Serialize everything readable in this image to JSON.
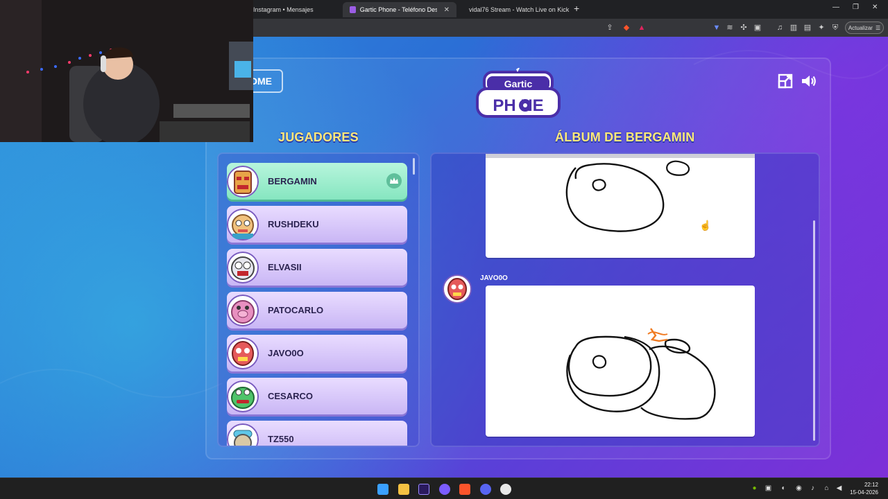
{
  "browser": {
    "tabs": [
      {
        "label": "Instagram • Mensajes",
        "active": false
      },
      {
        "label": "Gartic Phone - Teléfono Descon",
        "active": true
      },
      {
        "label": "vidal76 Stream - Watch Live on Kick",
        "active": false
      }
    ],
    "new_tab": "+",
    "update_label": "Actualizar"
  },
  "game": {
    "home_label": "OME",
    "logo_line1": "Gartic",
    "logo_line2": "PHONE",
    "players_title": "JUGADORES",
    "album_title": "ÁLBUM DE BERGAMIN",
    "players": [
      {
        "name": "BERGAMIN",
        "host": true
      },
      {
        "name": "RUSHDEKU",
        "host": false
      },
      {
        "name": "ELVASII",
        "host": false
      },
      {
        "name": "PATOCARLO",
        "host": false
      },
      {
        "name": "JAVO0O",
        "host": false
      },
      {
        "name": "CESARCO",
        "host": false
      },
      {
        "name": "TZ550",
        "host": false
      }
    ],
    "album_author": "JAVO0O"
  },
  "taskbar": {
    "time": "22:12",
    "date": "15-04-2026"
  },
  "colors": {
    "title_yellow": "#ffe97a",
    "host_row": "#86e6c0",
    "player_row": "#c9b6f5"
  }
}
